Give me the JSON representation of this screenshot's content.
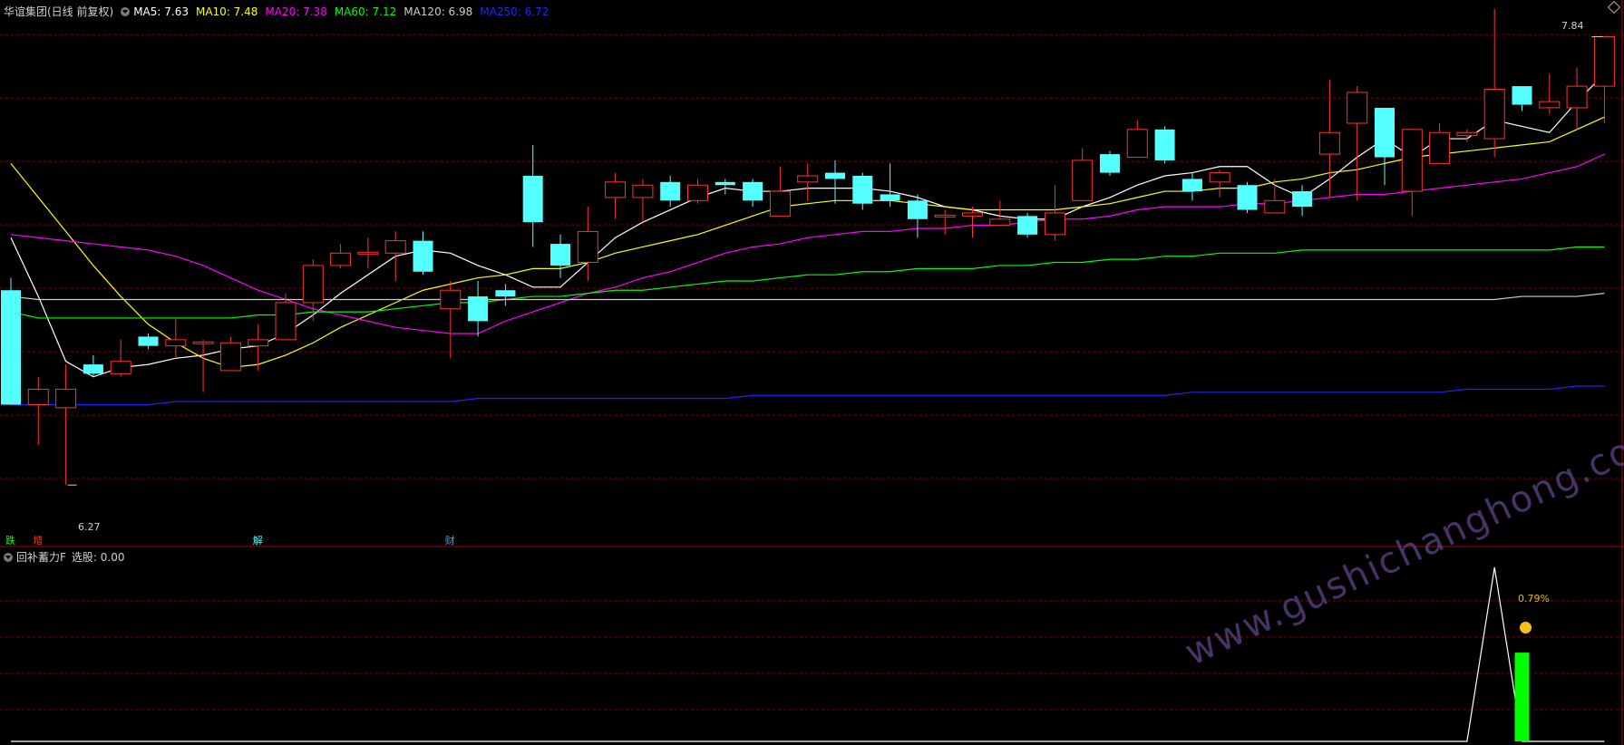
{
  "main_header": {
    "title": "华谊集团(日线 前复权)",
    "ma_values": [
      {
        "label": "MA5: 7.63",
        "color": "#ffffff"
      },
      {
        "label": "MA10: 7.48",
        "color": "#ffff00"
      },
      {
        "label": "MA20: 7.38",
        "color": "#ff00ff"
      },
      {
        "label": "MA60: 7.12",
        "color": "#00ff00"
      },
      {
        "label": "MA120: 6.98",
        "color": "#cccccc"
      },
      {
        "label": "MA250: 6.72",
        "color": "#2222ff"
      }
    ]
  },
  "sub_header": {
    "title": "回补蓄力F",
    "value_label": "选股: 0.00"
  },
  "markers": [
    {
      "text": "跌",
      "color": "#00ff00",
      "index": 0
    },
    {
      "text": "增",
      "color": "#ff3030",
      "index": 1
    },
    {
      "text": "解",
      "color": "#40ffff",
      "index": 9
    },
    {
      "text": "财",
      "color": "#40a0ff",
      "index": 16
    }
  ],
  "annotations": {
    "high_label": "7.84",
    "low_label": "6.27",
    "pct_label": "0.79%"
  },
  "watermark": "www.gushichanghong.com",
  "colors": {
    "up": "#ff3232",
    "down": "#54ffff",
    "grid": "#7f0000",
    "bar": "#00ff00"
  },
  "chart_data": {
    "type": "candlestick",
    "price_range": [
      6.2,
      7.9
    ],
    "candles": [
      [
        7.02,
        6.65,
        6.98,
        7.06
      ],
      [
        6.65,
        6.7,
        6.52,
        6.74
      ],
      [
        6.64,
        6.7,
        6.39,
        6.78
      ],
      [
        6.78,
        6.75,
        6.74,
        6.81
      ],
      [
        6.75,
        6.79,
        6.74,
        6.86
      ],
      [
        6.87,
        6.84,
        6.83,
        6.88
      ],
      [
        6.84,
        6.86,
        6.8,
        6.93
      ],
      [
        6.85,
        6.85,
        6.69,
        6.86
      ],
      [
        6.76,
        6.85,
        6.76,
        6.87
      ],
      [
        6.84,
        6.86,
        6.76,
        6.91
      ],
      [
        6.86,
        6.98,
        6.86,
        7.01
      ],
      [
        6.98,
        7.1,
        6.92,
        7.12
      ],
      [
        7.1,
        7.14,
        7.09,
        7.17
      ],
      [
        7.14,
        7.14,
        7.09,
        7.19
      ],
      [
        7.14,
        7.18,
        7.05,
        7.21
      ],
      [
        7.18,
        7.08,
        7.07,
        7.21
      ],
      [
        6.96,
        7.02,
        6.8,
        7.05
      ],
      [
        7.0,
        6.92,
        6.87,
        7.05
      ],
      [
        7.02,
        7.0,
        6.97,
        7.04
      ],
      [
        7.39,
        7.24,
        7.16,
        7.49
      ],
      [
        7.17,
        7.1,
        7.06,
        7.2
      ],
      [
        7.11,
        7.21,
        7.05,
        7.29
      ],
      [
        7.32,
        7.37,
        7.25,
        7.4
      ],
      [
        7.32,
        7.36,
        7.24,
        7.38
      ],
      [
        7.37,
        7.31,
        7.29,
        7.39
      ],
      [
        7.31,
        7.36,
        7.3,
        7.38
      ],
      [
        7.37,
        7.36,
        7.33,
        7.38
      ],
      [
        7.37,
        7.31,
        7.29,
        7.38
      ],
      [
        7.26,
        7.34,
        7.26,
        7.42
      ],
      [
        7.37,
        7.39,
        7.31,
        7.43
      ],
      [
        7.4,
        7.38,
        7.3,
        7.44
      ],
      [
        7.39,
        7.3,
        7.28,
        7.4
      ],
      [
        7.33,
        7.31,
        7.29,
        7.43
      ],
      [
        7.31,
        7.25,
        7.19,
        7.33
      ],
      [
        7.26,
        7.26,
        7.2,
        7.28
      ],
      [
        7.26,
        7.27,
        7.19,
        7.29
      ],
      [
        7.23,
        7.25,
        7.23,
        7.31
      ],
      [
        7.26,
        7.2,
        7.19,
        7.27
      ],
      [
        7.2,
        7.27,
        7.18,
        7.36
      ],
      [
        7.31,
        7.44,
        7.31,
        7.48
      ],
      [
        7.46,
        7.4,
        7.39,
        7.47
      ],
      [
        7.45,
        7.54,
        7.45,
        7.57
      ],
      [
        7.54,
        7.44,
        7.43,
        7.55
      ],
      [
        7.38,
        7.34,
        7.31,
        7.4
      ],
      [
        7.37,
        7.4,
        7.32,
        7.41
      ],
      [
        7.36,
        7.28,
        7.27,
        7.37
      ],
      [
        7.27,
        7.31,
        7.27,
        7.38
      ],
      [
        7.34,
        7.29,
        7.26,
        7.36
      ],
      [
        7.46,
        7.53,
        7.32,
        7.7
      ],
      [
        7.56,
        7.66,
        7.31,
        7.68
      ],
      [
        7.61,
        7.45,
        7.36,
        7.61
      ],
      [
        7.34,
        7.54,
        7.26,
        7.53
      ],
      [
        7.43,
        7.53,
        7.43,
        7.56
      ],
      [
        7.52,
        7.53,
        7.5,
        7.54
      ],
      [
        7.51,
        7.67,
        7.45,
        7.93
      ],
      [
        7.68,
        7.62,
        7.6,
        7.66
      ],
      [
        7.61,
        7.63,
        7.59,
        7.72
      ],
      [
        7.61,
        7.68,
        7.54,
        7.74
      ],
      [
        7.68,
        7.84,
        7.56,
        7.84
      ]
    ],
    "ma": {
      "MA5": {
        "color": "#ffffff",
        "values": [
          7.19,
          7.0,
          6.79,
          6.74,
          6.77,
          6.78,
          6.8,
          6.81,
          6.83,
          6.84,
          6.88,
          6.94,
          7.01,
          7.07,
          7.13,
          7.15,
          7.14,
          7.1,
          7.07,
          7.03,
          7.03,
          7.11,
          7.19,
          7.24,
          7.28,
          7.32,
          7.35,
          7.34,
          7.34,
          7.35,
          7.35,
          7.35,
          7.34,
          7.32,
          7.29,
          7.28,
          7.26,
          7.25,
          7.25,
          7.29,
          7.32,
          7.36,
          7.39,
          7.4,
          7.42,
          7.42,
          7.36,
          7.32,
          7.38,
          7.45,
          7.51,
          7.45,
          7.51,
          7.51,
          7.57,
          7.55,
          7.53,
          7.63,
          7.72
        ]
      },
      "MA10": {
        "color": "#ffff00",
        "values": [
          7.43,
          7.32,
          7.21,
          7.1,
          7.0,
          6.91,
          6.85,
          6.8,
          6.77,
          6.78,
          6.81,
          6.85,
          6.9,
          6.94,
          6.98,
          7.02,
          7.04,
          7.06,
          7.07,
          7.09,
          7.09,
          7.11,
          7.14,
          7.16,
          7.18,
          7.2,
          7.23,
          7.26,
          7.29,
          7.3,
          7.31,
          7.31,
          7.31,
          7.3,
          7.29,
          7.28,
          7.28,
          7.28,
          7.28,
          7.29,
          7.3,
          7.32,
          7.34,
          7.34,
          7.35,
          7.35,
          7.37,
          7.38,
          7.4,
          7.41,
          7.43,
          7.45,
          7.46,
          7.47,
          7.48,
          7.49,
          7.5,
          7.54,
          7.58
        ]
      },
      "MA20": {
        "color": "#ff00ff",
        "values": [
          7.2,
          7.19,
          7.18,
          7.17,
          7.16,
          7.15,
          7.13,
          7.1,
          7.06,
          7.02,
          6.99,
          6.96,
          6.94,
          6.92,
          6.9,
          6.89,
          6.88,
          6.88,
          6.92,
          6.95,
          6.98,
          7.01,
          7.03,
          7.06,
          7.08,
          7.11,
          7.14,
          7.16,
          7.17,
          7.19,
          7.2,
          7.21,
          7.21,
          7.22,
          7.22,
          7.23,
          7.23,
          7.24,
          7.25,
          7.25,
          7.26,
          7.28,
          7.29,
          7.29,
          7.29,
          7.3,
          7.3,
          7.31,
          7.32,
          7.33,
          7.33,
          7.34,
          7.35,
          7.36,
          7.37,
          7.38,
          7.4,
          7.42,
          7.46
        ]
      },
      "MA60": {
        "color": "#00ff00",
        "values": [
          6.95,
          6.93,
          6.93,
          6.93,
          6.93,
          6.93,
          6.93,
          6.93,
          6.93,
          6.94,
          6.94,
          6.95,
          6.95,
          6.95,
          6.96,
          6.97,
          6.98,
          6.98,
          6.99,
          7.0,
          7.0,
          7.01,
          7.02,
          7.02,
          7.03,
          7.04,
          7.05,
          7.05,
          7.06,
          7.07,
          7.07,
          7.08,
          7.08,
          7.09,
          7.09,
          7.09,
          7.1,
          7.1,
          7.11,
          7.11,
          7.12,
          7.12,
          7.13,
          7.13,
          7.14,
          7.14,
          7.14,
          7.15,
          7.15,
          7.15,
          7.15,
          7.15,
          7.15,
          7.15,
          7.15,
          7.15,
          7.15,
          7.16,
          7.16
        ]
      },
      "MA120": {
        "color": "#cccccc",
        "values": [
          7.0,
          6.99,
          6.99,
          6.99,
          6.99,
          6.99,
          6.99,
          6.99,
          6.99,
          6.99,
          6.99,
          6.99,
          6.99,
          6.99,
          6.99,
          6.99,
          6.99,
          6.99,
          6.99,
          6.99,
          6.99,
          6.99,
          6.99,
          6.99,
          6.99,
          6.99,
          6.99,
          6.99,
          6.99,
          6.99,
          6.99,
          6.99,
          6.99,
          6.99,
          6.99,
          6.99,
          6.99,
          6.99,
          6.99,
          6.99,
          6.99,
          6.99,
          6.99,
          6.99,
          6.99,
          6.99,
          6.99,
          6.99,
          6.99,
          6.99,
          6.99,
          6.99,
          6.99,
          6.99,
          6.99,
          7.0,
          7.0,
          7.0,
          7.01
        ]
      },
      "MA250": {
        "color": "#2222ff",
        "values": [
          6.65,
          6.65,
          6.65,
          6.65,
          6.65,
          6.65,
          6.66,
          6.66,
          6.66,
          6.66,
          6.66,
          6.66,
          6.66,
          6.66,
          6.66,
          6.66,
          6.66,
          6.67,
          6.67,
          6.67,
          6.67,
          6.67,
          6.67,
          6.67,
          6.67,
          6.67,
          6.67,
          6.68,
          6.68,
          6.68,
          6.68,
          6.68,
          6.68,
          6.68,
          6.68,
          6.68,
          6.68,
          6.68,
          6.68,
          6.68,
          6.68,
          6.68,
          6.68,
          6.69,
          6.69,
          6.69,
          6.69,
          6.69,
          6.69,
          6.69,
          6.69,
          6.69,
          6.69,
          6.7,
          6.7,
          6.7,
          6.7,
          6.71,
          6.71
        ]
      }
    },
    "indicator": {
      "name": "回补蓄力F",
      "line_values": [
        0,
        0,
        0,
        0,
        0,
        0,
        0,
        0,
        0,
        0,
        0,
        0,
        0,
        0,
        0,
        0,
        0,
        0,
        0,
        0,
        0,
        0,
        0,
        0,
        0,
        0,
        0,
        0,
        0,
        0,
        0,
        0,
        0,
        0,
        0,
        0,
        0,
        0,
        0,
        0,
        0,
        0,
        0,
        0,
        0,
        0,
        0,
        0,
        0,
        0,
        0,
        0,
        0,
        0,
        1.0,
        0,
        0,
        0,
        0
      ],
      "bar_index": 55,
      "bar_value": 0.51,
      "range": [
        0,
        1.0
      ]
    }
  }
}
